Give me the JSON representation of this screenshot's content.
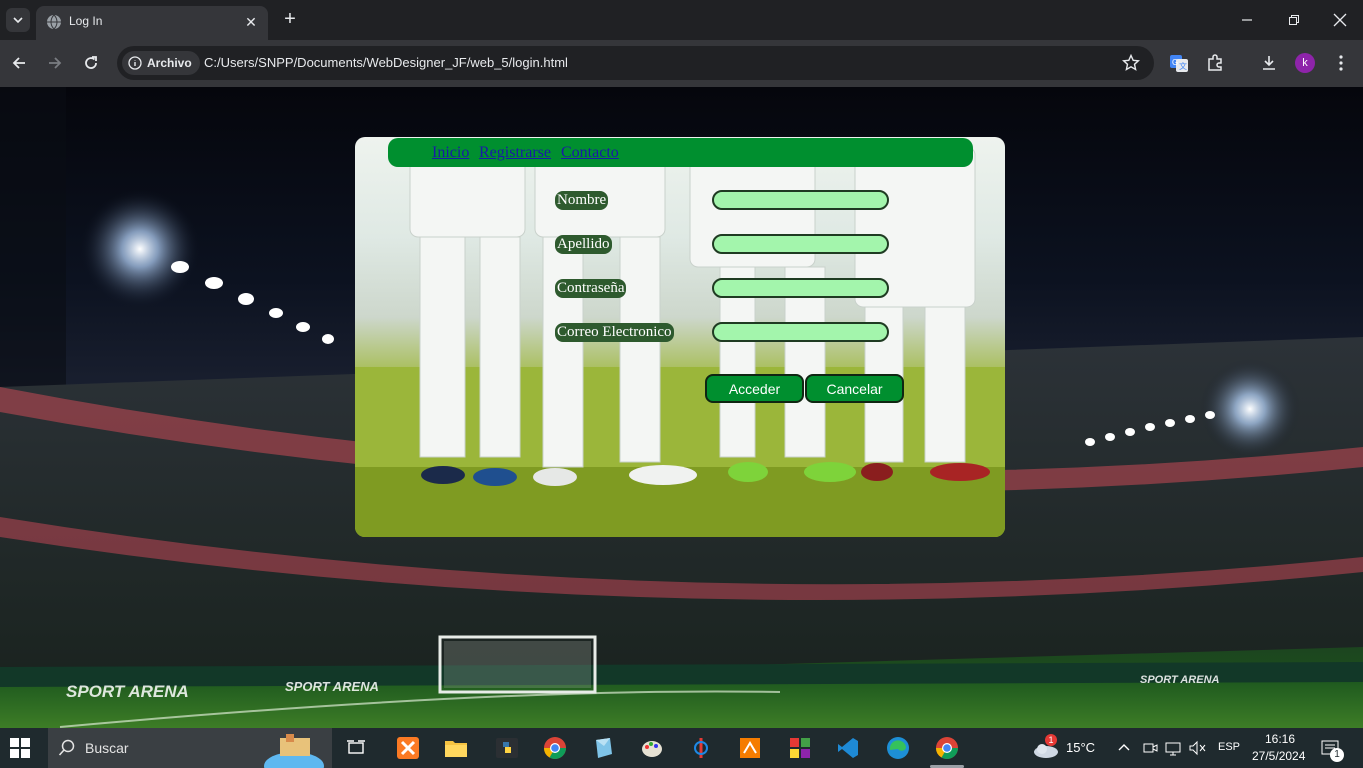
{
  "browser": {
    "tab_title": "Log In",
    "chip_label": "Archivo",
    "url": "C:/Users/SNPP/Documents/WebDesigner_JF/web_5/login.html",
    "profile_initial": "k"
  },
  "page": {
    "nav": [
      "Inicio",
      "Registrarse",
      "Contacto"
    ],
    "form": {
      "fields": [
        {
          "label": "Nombre",
          "value": ""
        },
        {
          "label": "Apellido",
          "value": ""
        },
        {
          "label": "Contraseña",
          "value": ""
        },
        {
          "label": "Correo Electronico",
          "value": ""
        }
      ],
      "submit_label": "Acceder",
      "cancel_label": "Cancelar"
    },
    "colors": {
      "accent": "#008f2f",
      "input_bg": "#a3f5ac"
    }
  },
  "taskbar": {
    "search_label": "Buscar",
    "weather": "15°C",
    "weather_badge": "1",
    "language": "ESP",
    "time": "16:16",
    "date": "27/5/2024",
    "notifications": "1",
    "apps": [
      "task-view-icon",
      "xampp-icon",
      "file-explorer-icon",
      "python-icon",
      "chrome-icon",
      "app-icon",
      "paint-icon",
      "app-icon",
      "app-icon",
      "app-icon",
      "vscode-icon",
      "edge-icon",
      "chrome-icon"
    ]
  }
}
